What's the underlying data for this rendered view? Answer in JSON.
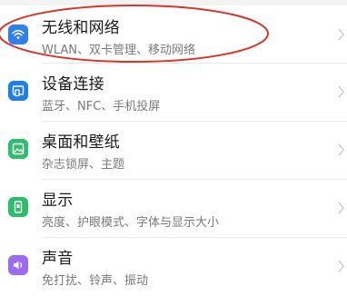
{
  "settings": {
    "items": [
      {
        "title": "无线和网络",
        "subtitle": "WLAN、双卡管理、移动网络",
        "icon": "wifi-icon",
        "color": "#2f80ed"
      },
      {
        "title": "设备连接",
        "subtitle": "蓝牙、NFC、手机投屏",
        "icon": "device-connect-icon",
        "color": "#1f7fe6"
      },
      {
        "title": "桌面和壁纸",
        "subtitle": "杂志锁屏、主题",
        "icon": "wallpaper-icon",
        "color": "#2ebd6b"
      },
      {
        "title": "显示",
        "subtitle": "亮度、护眼模式、字体与显示大小",
        "icon": "display-icon",
        "color": "#2ebd6b"
      },
      {
        "title": "声音",
        "subtitle": "免打扰、铃声、振动",
        "icon": "sound-icon",
        "color": "#9b6cf2"
      }
    ]
  },
  "annotation": {
    "color": "#d9352b"
  }
}
